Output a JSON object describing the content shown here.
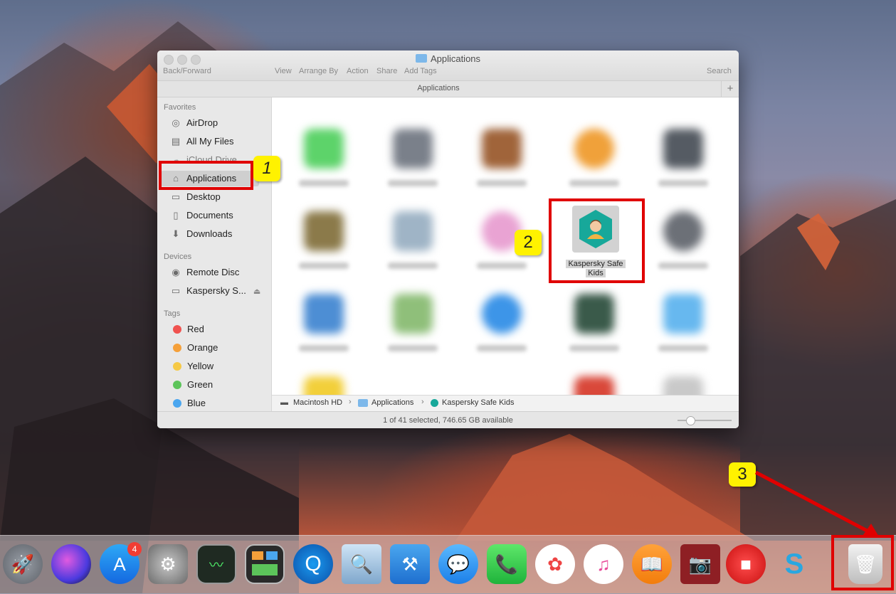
{
  "window": {
    "title": "Applications",
    "toolbar": {
      "back_forward": "Back/Forward",
      "view": "View",
      "arrange_by": "Arrange By",
      "action": "Action",
      "share": "Share",
      "add_tags": "Add Tags",
      "search": "Search"
    },
    "path_header": "Applications",
    "add_tab": "+"
  },
  "sidebar": {
    "favorites_header": "Favorites",
    "favorites": [
      {
        "label": "AirDrop",
        "icon": "airdrop-icon"
      },
      {
        "label": "All My Files",
        "icon": "all-files-icon"
      },
      {
        "label": "iCloud Drive",
        "icon": "cloud-icon"
      },
      {
        "label": "Applications",
        "icon": "applications-icon"
      },
      {
        "label": "Desktop",
        "icon": "desktop-icon"
      },
      {
        "label": "Documents",
        "icon": "documents-icon"
      },
      {
        "label": "Downloads",
        "icon": "downloads-icon"
      }
    ],
    "devices_header": "Devices",
    "devices": [
      {
        "label": "Remote Disc",
        "icon": "disc-icon"
      },
      {
        "label": "Kaspersky S...",
        "icon": "drive-icon"
      }
    ],
    "tags_header": "Tags",
    "tags": [
      {
        "label": "Red",
        "color": "#f0524f"
      },
      {
        "label": "Orange",
        "color": "#f5a03a"
      },
      {
        "label": "Yellow",
        "color": "#f6c945"
      },
      {
        "label": "Green",
        "color": "#5cc45a"
      },
      {
        "label": "Blue",
        "color": "#4aa6ef"
      }
    ]
  },
  "content": {
    "selected_app": {
      "line1": "Kaspersky Safe",
      "line2": "Kids",
      "icon": "kaspersky-safe-kids-icon"
    }
  },
  "pathbar": {
    "items": [
      "Macintosh HD",
      "Applications",
      "Kaspersky Safe Kids"
    ],
    "separator": "›"
  },
  "status": {
    "text": "1 of 41 selected, 746.65 GB available",
    "zoom_slider": 0.25
  },
  "annotations": {
    "step1": "1",
    "step2": "2",
    "step3": "3"
  },
  "dock": {
    "app_store_badge": "4",
    "items": [
      "launchpad-icon",
      "siri-icon",
      "app-store-icon",
      "system-preferences-icon",
      "activity-monitor-icon",
      "mission-control-icon",
      "quicktime-icon",
      "preview-icon",
      "xcode-icon",
      "messages-icon",
      "facetime-icon",
      "photos-icon",
      "itunes-icon",
      "ibooks-icon",
      "photo-booth-icon",
      "recorder-icon",
      "screenflow-icon",
      "trash-icon"
    ]
  },
  "colors": {
    "annotation_red": "#e00000",
    "badge_yellow": "#fff200",
    "kaspersky_teal": "#17a89a"
  }
}
